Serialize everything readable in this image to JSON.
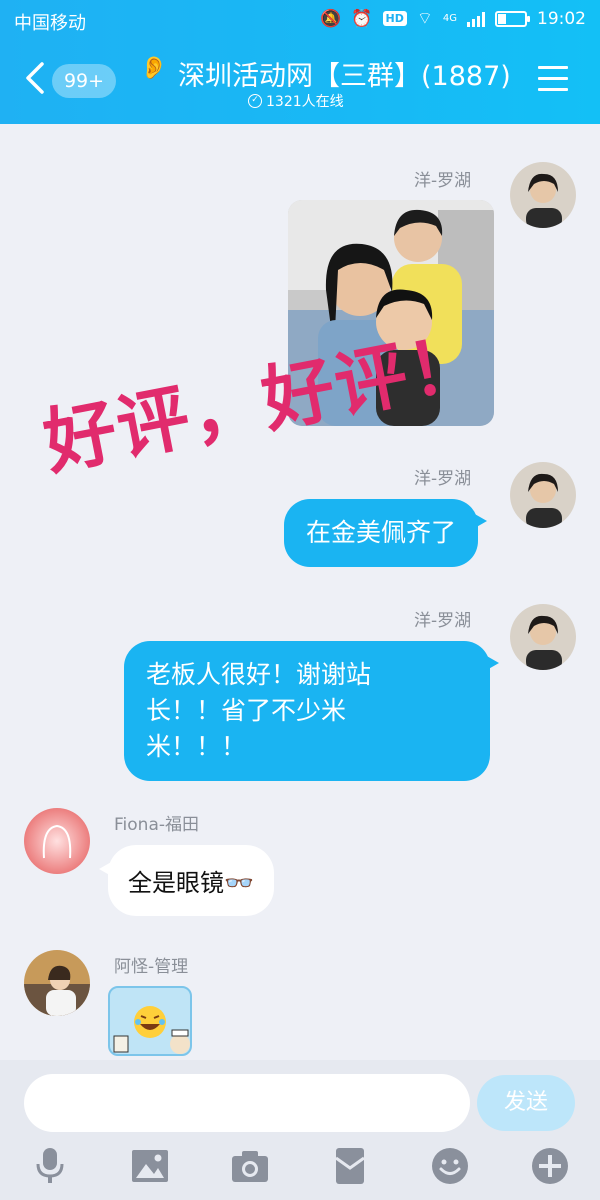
{
  "status_bar": {
    "carrier": "中国移动",
    "time": "19:02",
    "network": "4G",
    "hd": "HD"
  },
  "header": {
    "unread_badge": "99+",
    "title": "深圳活动网【三群】(1887)",
    "online_count": "1321人在线"
  },
  "messages": [
    {
      "sender": "洋-罗湖",
      "type": "image",
      "side": "right"
    },
    {
      "sender": "洋-罗湖",
      "type": "text",
      "side": "right",
      "text": "在金美佩齐了"
    },
    {
      "sender": "洋-罗湖",
      "type": "text",
      "side": "right",
      "lines": [
        "老板人很好！谢谢站",
        "长！！省了不少米",
        "米！！！"
      ]
    },
    {
      "sender": "Fiona-福田",
      "type": "text",
      "side": "left",
      "text": "全是眼镜👓"
    },
    {
      "sender": "阿怪-管理",
      "type": "sticker",
      "side": "left"
    }
  ],
  "overlay_text": "好评，好评！",
  "composer": {
    "placeholder": "",
    "send_label": "发送"
  },
  "toolbar_icons": [
    "microphone-icon",
    "image-icon",
    "camera-icon",
    "red-packet-icon",
    "emoji-icon",
    "plus-icon"
  ],
  "colors": {
    "header": "#1fb1f3",
    "bubble_right": "#1ab4f2",
    "bubble_left": "#ffffff",
    "overlay": "#e12b6d",
    "background": "#eef0f6"
  }
}
